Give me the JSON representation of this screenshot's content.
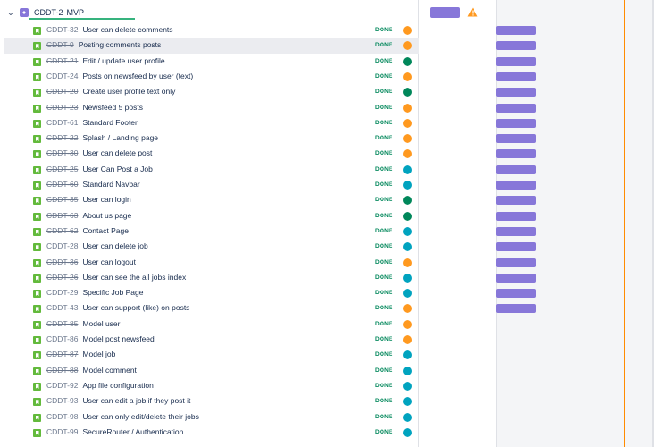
{
  "epic": {
    "key": "CDDT-2",
    "name": "MVP",
    "color": "#8777d9",
    "expand_icon": "chevron-down-icon",
    "warning_icon": "warning-icon"
  },
  "status_color": "#00875a",
  "bar_color": "#8777d9",
  "today_line_color": "#ff8b00",
  "stories": [
    {
      "key": "CDDT-32",
      "summary": "User can delete comments",
      "status": "DONE",
      "avatar": "orange",
      "strike": false,
      "bar": true
    },
    {
      "key": "CDDT-9",
      "summary": "Posting comments posts",
      "status": "DONE",
      "avatar": "orange",
      "strike": true,
      "bar": true
    },
    {
      "key": "CDDT-21",
      "summary": "Edit / update user profile",
      "status": "DONE",
      "avatar": "green",
      "strike": true,
      "bar": true
    },
    {
      "key": "CDDT-24",
      "summary": "Posts on newsfeed by user (text)",
      "status": "DONE",
      "avatar": "orange",
      "strike": false,
      "bar": true
    },
    {
      "key": "CDDT-20",
      "summary": "Create user profile text only",
      "status": "DONE",
      "avatar": "green",
      "strike": true,
      "bar": true
    },
    {
      "key": "CDDT-23",
      "summary": "Newsfeed 5 posts",
      "status": "DONE",
      "avatar": "orange",
      "strike": true,
      "bar": true
    },
    {
      "key": "CDDT-61",
      "summary": "Standard Footer",
      "status": "DONE",
      "avatar": "orange",
      "strike": false,
      "bar": true
    },
    {
      "key": "CDDT-22",
      "summary": "Splash / Landing page",
      "status": "DONE",
      "avatar": "orange",
      "strike": true,
      "bar": true
    },
    {
      "key": "CDDT-30",
      "summary": "User can delete post",
      "status": "DONE",
      "avatar": "orange",
      "strike": true,
      "bar": true
    },
    {
      "key": "CDDT-25",
      "summary": "User Can Post a Job",
      "status": "DONE",
      "avatar": "teal",
      "strike": true,
      "bar": true
    },
    {
      "key": "CDDT-60",
      "summary": "Standard Navbar",
      "status": "DONE",
      "avatar": "teal",
      "strike": true,
      "bar": true
    },
    {
      "key": "CDDT-35",
      "summary": "User can login",
      "status": "DONE",
      "avatar": "green",
      "strike": true,
      "bar": true
    },
    {
      "key": "CDDT-63",
      "summary": "About us page",
      "status": "DONE",
      "avatar": "green",
      "strike": true,
      "bar": true
    },
    {
      "key": "CDDT-62",
      "summary": "Contact Page",
      "status": "DONE",
      "avatar": "teal",
      "strike": true,
      "bar": true
    },
    {
      "key": "CDDT-28",
      "summary": "User can delete job",
      "status": "DONE",
      "avatar": "teal",
      "strike": false,
      "bar": true
    },
    {
      "key": "CDDT-36",
      "summary": "User can logout",
      "status": "DONE",
      "avatar": "orange",
      "strike": true,
      "bar": true
    },
    {
      "key": "CDDT-26",
      "summary": "User can see the all jobs index",
      "status": "DONE",
      "avatar": "teal",
      "strike": true,
      "bar": true
    },
    {
      "key": "CDDT-29",
      "summary": "Specific Job Page",
      "status": "DONE",
      "avatar": "teal",
      "strike": false,
      "bar": true
    },
    {
      "key": "CDDT-43",
      "summary": "User can support (like) on posts",
      "status": "DONE",
      "avatar": "orange",
      "strike": true,
      "bar": true
    },
    {
      "key": "CDDT-85",
      "summary": "Model user",
      "status": "DONE",
      "avatar": "orange",
      "strike": true,
      "bar": false
    },
    {
      "key": "CDDT-86",
      "summary": "Model post newsfeed",
      "status": "DONE",
      "avatar": "orange",
      "strike": false,
      "bar": false
    },
    {
      "key": "CDDT-87",
      "summary": "Model job",
      "status": "DONE",
      "avatar": "teal",
      "strike": true,
      "bar": false
    },
    {
      "key": "CDDT-88",
      "summary": "Model comment",
      "status": "DONE",
      "avatar": "teal",
      "strike": true,
      "bar": false
    },
    {
      "key": "CDDT-92",
      "summary": "App file configuration",
      "status": "DONE",
      "avatar": "teal",
      "strike": false,
      "bar": false
    },
    {
      "key": "CDDT-93",
      "summary": "User can edit a job if they post it",
      "status": "DONE",
      "avatar": "teal",
      "strike": true,
      "bar": false
    },
    {
      "key": "CDDT-98",
      "summary": "User can only edit/delete their jobs",
      "status": "DONE",
      "avatar": "teal",
      "strike": true,
      "bar": false
    },
    {
      "key": "CDDT-99",
      "summary": "SecureRouter / Authentication",
      "status": "DONE",
      "avatar": "teal",
      "strike": false,
      "bar": false
    }
  ],
  "highlighted_row": 1,
  "avatar_colors": {
    "orange": "#ff991f",
    "green": "#00875a",
    "teal": "#00a3bf"
  }
}
